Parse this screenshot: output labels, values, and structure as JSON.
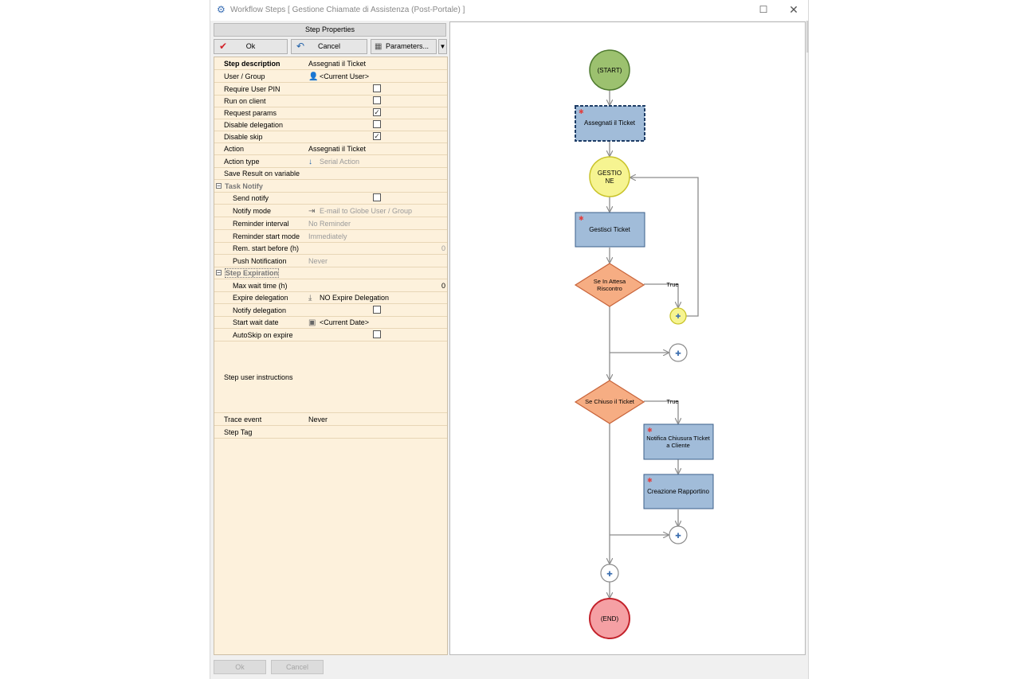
{
  "window": {
    "title": "Workflow Steps [ Gestione Chiamate di Assistenza (Post-Portale) ]",
    "maximize_glyph": "☐",
    "close_glyph": "✕"
  },
  "panel": {
    "header": "Step Properties",
    "toolbar": {
      "ok": "Ok",
      "cancel": "Cancel",
      "parameters": "Parameters...",
      "dropdown_glyph": "▼"
    }
  },
  "properties": {
    "step_description": {
      "label": "Step description",
      "value": "Assegnati il Ticket"
    },
    "user_group": {
      "label": "User / Group",
      "value": "<Current User>"
    },
    "require_user_pin": {
      "label": "Require User PIN",
      "checked": false
    },
    "run_on_client": {
      "label": "Run on client",
      "checked": false
    },
    "request_params": {
      "label": "Request params",
      "checked": true
    },
    "disable_delegation": {
      "label": "Disable delegation",
      "checked": false
    },
    "disable_skip": {
      "label": "Disable skip",
      "checked": true
    },
    "action": {
      "label": "Action",
      "value": "Assegnati il Ticket"
    },
    "action_type": {
      "label": "Action type",
      "value": "Serial Action"
    },
    "save_result": {
      "label": "Save Result on variable"
    },
    "task_notify": {
      "title": "Task Notify",
      "send_notify": {
        "label": "Send notify",
        "checked": false
      },
      "notify_mode": {
        "label": "Notify mode",
        "value": "E-mail to Globe User / Group"
      },
      "reminder_interval": {
        "label": "Reminder interval",
        "value": "No Reminder"
      },
      "reminder_start_mode": {
        "label": "Reminder start mode",
        "value": "Immediately"
      },
      "rem_start_before": {
        "label": "Rem. start before (h)",
        "value": "0"
      },
      "push_notification": {
        "label": "Push Notification",
        "value": "Never"
      }
    },
    "step_expiration": {
      "title": "Step Expiration",
      "max_wait_time": {
        "label": "Max wait time (h)",
        "value": "0"
      },
      "expire_delegation": {
        "label": "Expire delegation",
        "value": "NO Expire Delegation"
      },
      "notify_delegation": {
        "label": "Notify delegation",
        "checked": false
      },
      "start_wait_date": {
        "label": "Start wait date",
        "value": "<Current Date>"
      },
      "autoskip_on_expire": {
        "label": "AutoSkip on expire",
        "checked": false
      }
    },
    "step_user_instructions": {
      "label": "Step user instructions"
    },
    "trace_event": {
      "label": "Trace event",
      "value": "Never"
    },
    "step_tag": {
      "label": "Step Tag"
    }
  },
  "flow": {
    "start": "(START)",
    "step1": "Assegnati il Ticket",
    "gestione_line1": "GESTIO",
    "gestione_line2": "NE",
    "step2": "Gestisci Ticket",
    "decision1_line1": "Se In Attesa",
    "decision1_line2": "Riscontro",
    "true1": "True",
    "decision2": "Se Chiuso il Ticket",
    "true2": "True",
    "step3_line1": "Notifica Chiusura TIcket",
    "step3_line2": "a Cliente",
    "step4": "Creazione Rapportino",
    "end": "(END)",
    "colors": {
      "start_fill": "#9cc16f",
      "start_stroke": "#4e7a2e",
      "task_fill": "#a1bcd9",
      "task_stroke": "#3c5f8a",
      "state_fill": "#f6f491",
      "state_stroke": "#c9c32a",
      "decision_fill": "#f6ad83",
      "decision_stroke": "#c8643a",
      "end_fill": "#f5a0a4",
      "end_stroke": "#c3222b",
      "connector": "#8c8c8c"
    }
  },
  "footer": {
    "ok": "Ok",
    "cancel": "Cancel"
  }
}
